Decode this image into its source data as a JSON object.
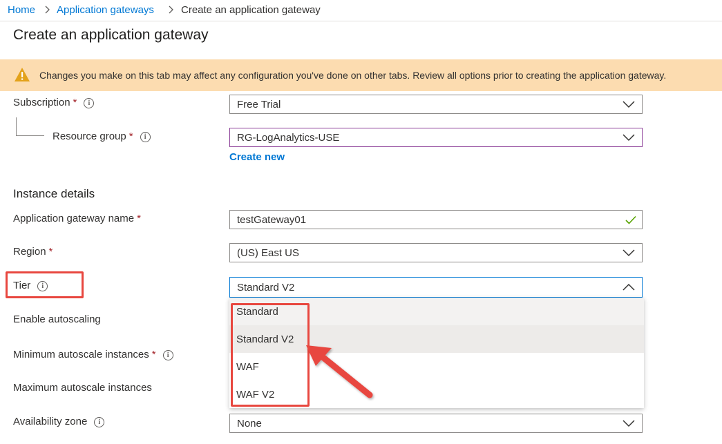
{
  "breadcrumb": {
    "items": [
      {
        "label": "Home"
      },
      {
        "label": "Application gateways"
      },
      {
        "label": "Create an application gateway"
      }
    ]
  },
  "page": {
    "title": "Create an application gateway"
  },
  "banner": {
    "text": "Changes you make on this tab may affect any configuration you've done on other tabs. Review all options prior to creating the application gateway.",
    "icon": "warning-icon",
    "color": "#fcdcb0"
  },
  "form": {
    "subscription": {
      "label": "Subscription",
      "required": "*",
      "value": "Free Trial"
    },
    "resource_group": {
      "label": "Resource group",
      "required": "*",
      "value": "RG-LogAnalytics-USE",
      "create_new": "Create new"
    },
    "instance_details_heading": "Instance details",
    "gateway_name": {
      "label": "Application gateway name",
      "required": "*",
      "value": "testGateway01",
      "valid_icon": "checkmark-icon"
    },
    "region": {
      "label": "Region",
      "required": "*",
      "value": "(US) East US"
    },
    "tier": {
      "label": "Tier",
      "value": "Standard V2",
      "expanded": true,
      "options": [
        "Standard",
        "Standard V2",
        "WAF",
        "WAF V2"
      ]
    },
    "autoscaling": {
      "label": "Enable autoscaling"
    },
    "min_instances": {
      "label": "Minimum autoscale instances",
      "required": "*"
    },
    "max_instances": {
      "label": "Maximum autoscale instances"
    },
    "availability_zone": {
      "label": "Availability zone",
      "value": "None"
    }
  },
  "annotation_color": "#e8473f",
  "accent_color": "#0078d4"
}
